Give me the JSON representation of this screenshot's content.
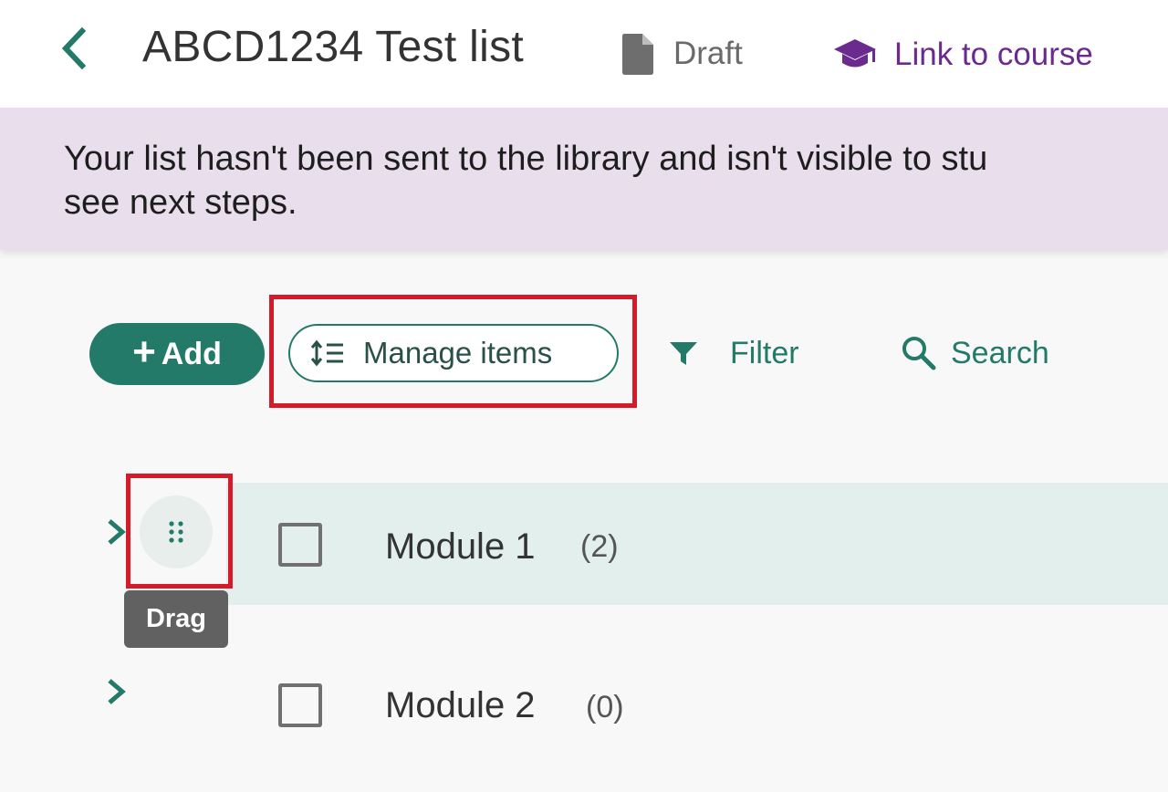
{
  "header": {
    "title": "ABCD1234 Test list",
    "status_label": "Draft",
    "link_course_label": "Link to course"
  },
  "banner": {
    "message": "Your list hasn't been sent to the library and isn't visible to stu",
    "message_line2": "see next steps."
  },
  "toolbar": {
    "add_label": "Add",
    "manage_label": "Manage items",
    "filter_label": "Filter",
    "search_label": "Search"
  },
  "tooltip": {
    "drag_label": "Drag"
  },
  "modules": [
    {
      "name": "Module 1",
      "count": "(2)",
      "highlighted": true
    },
    {
      "name": "Module 2",
      "count": "(0)",
      "highlighted": false
    }
  ],
  "colors": {
    "accent": "#237a68",
    "course_link": "#6b2b8e",
    "banner_bg": "#e9dfec",
    "row_highlight": "#e2efed",
    "annotation_red": "#d51b2a"
  }
}
